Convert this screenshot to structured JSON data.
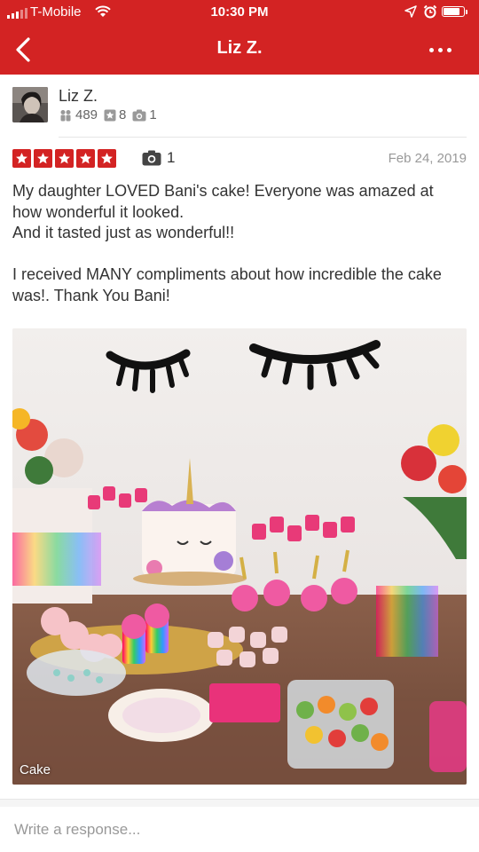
{
  "status_bar": {
    "carrier": "T-Mobile",
    "time": "10:30 PM",
    "battery_level": 0.85
  },
  "nav": {
    "title": "Liz Z.",
    "back_icon": "chevron-left-icon",
    "more_icon": "more-horizontal-icon"
  },
  "user": {
    "name": "Liz Z.",
    "friends": "489",
    "reviews": "8",
    "photos": "1"
  },
  "review": {
    "rating": 5,
    "photo_count": "1",
    "date": "Feb 24, 2019",
    "paragraphs": [
      "My daughter LOVED Bani's cake! Everyone was amazed at how wonderful it looked.\nAnd it tasted just as wonderful!!",
      "I received MANY compliments about how incredible the cake was!. Thank You Bani!"
    ]
  },
  "photo": {
    "caption": "Cake"
  },
  "response": {
    "placeholder": "Write a response..."
  },
  "colors": {
    "brand_red": "#d32323",
    "text": "#333333",
    "muted": "#999999"
  }
}
